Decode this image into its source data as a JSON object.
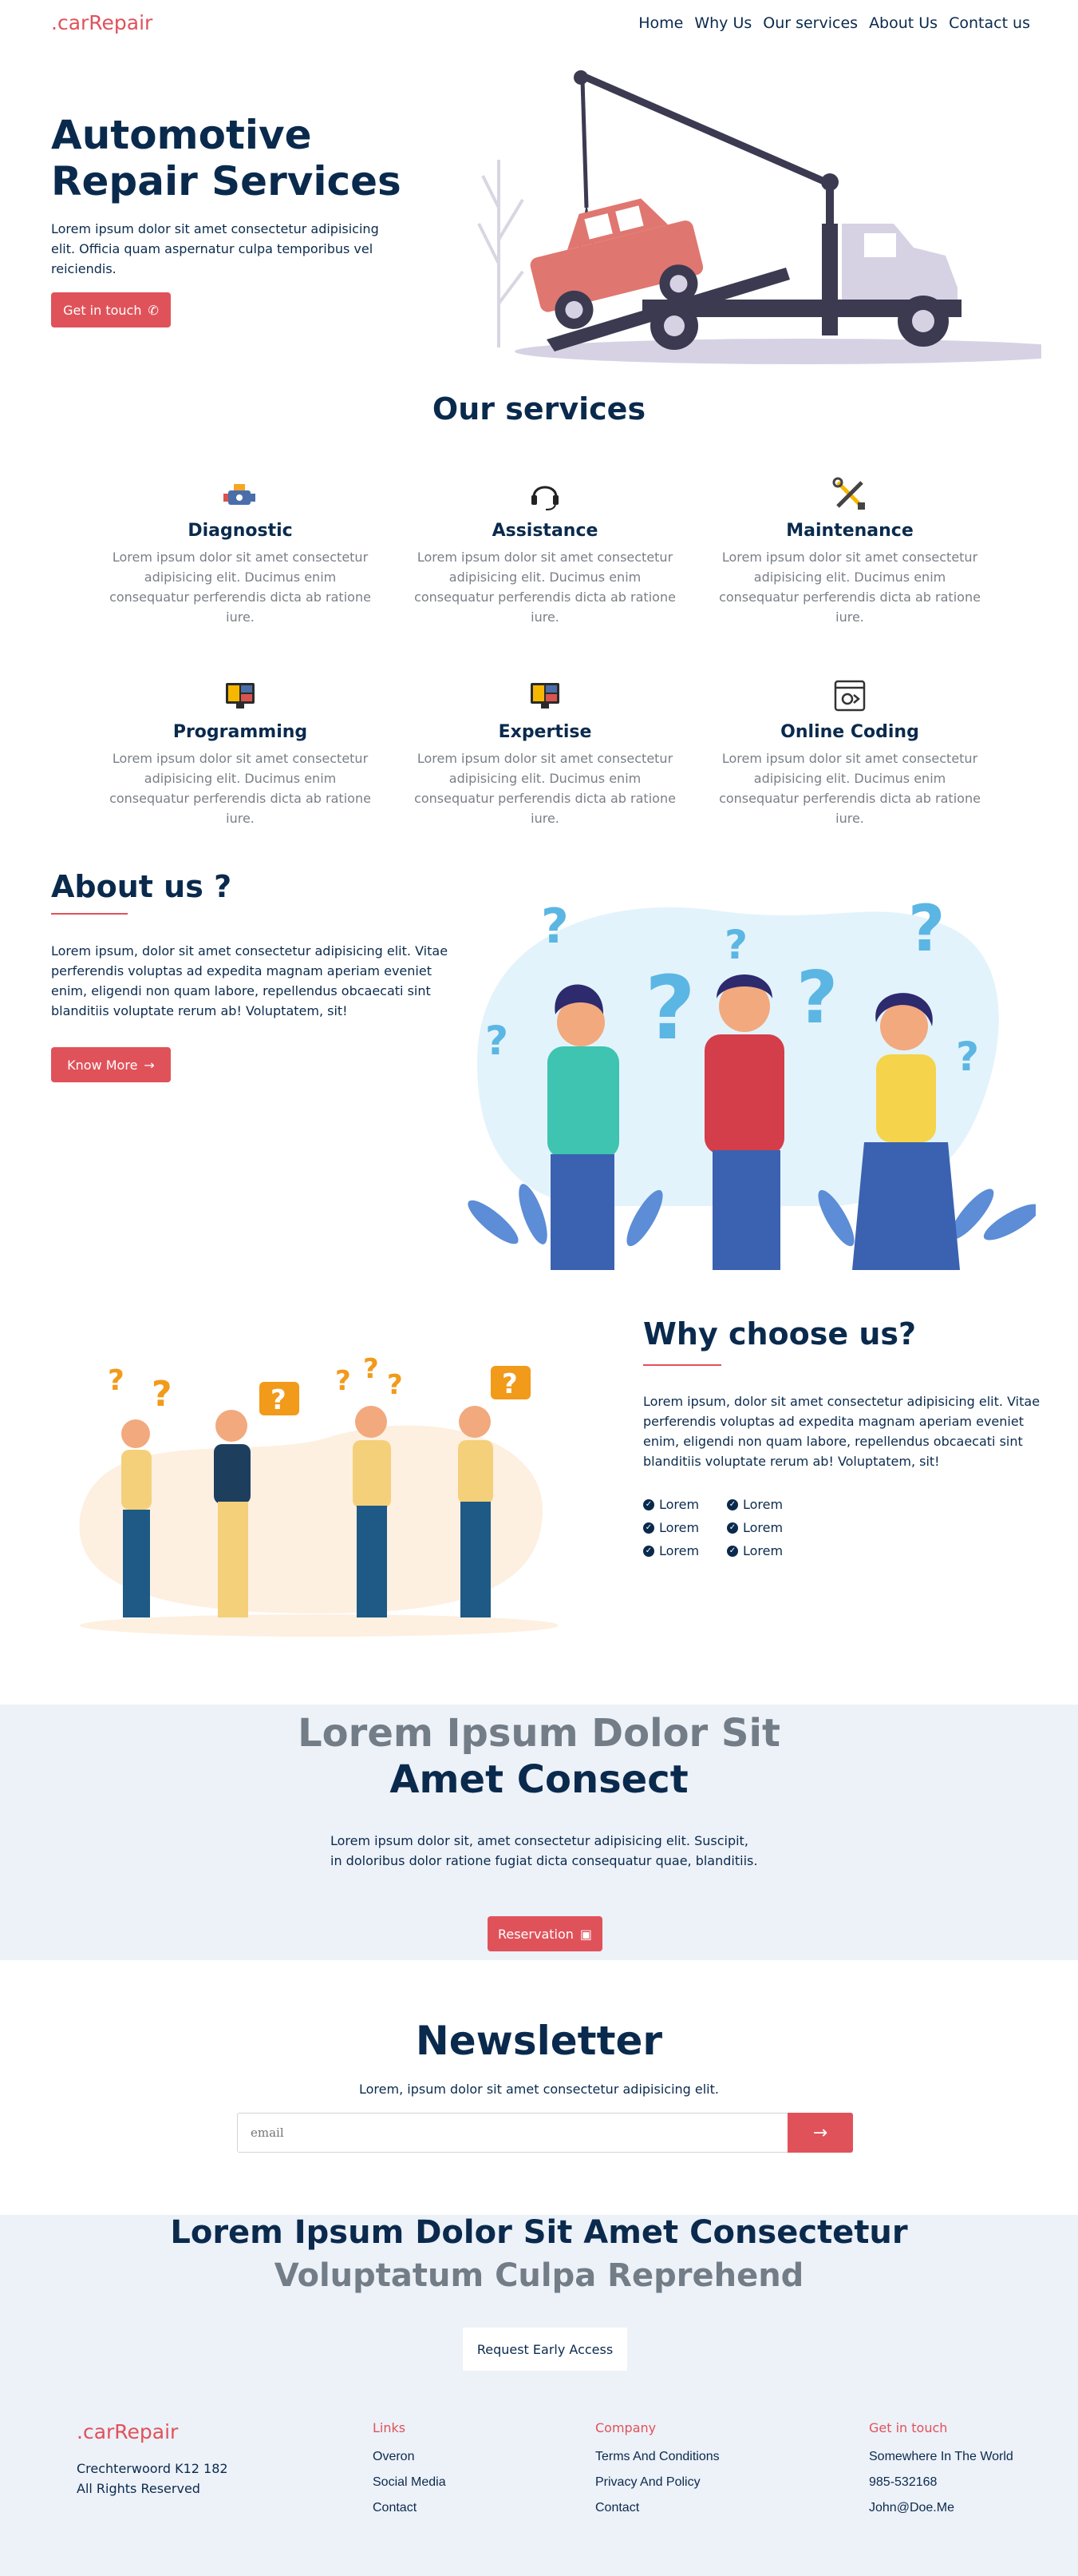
{
  "brand": {
    "logo": ".carRepair",
    "accent": "#e0525a",
    "navy": "#0a2a4d"
  },
  "nav": {
    "links": [
      "Home",
      "Why Us",
      "Our services",
      "About Us",
      "Contact us"
    ]
  },
  "hero": {
    "title": "Automotive Repair Services",
    "text": "Lorem ipsum dolor sit amet consectetur adipisicing elit. Officia quam aspernatur culpa temporibus vel reiciendis.",
    "button": "Get in touch",
    "button_icon": "phone-icon"
  },
  "services": {
    "title": "Our services",
    "items": [
      {
        "name": "Diagnostic",
        "icon": "engine-icon",
        "text": "Lorem ipsum dolor sit amet consectetur adipisicing elit. Ducimus enim consequatur perferendis dicta ab ratione iure."
      },
      {
        "name": "Assistance",
        "icon": "headset-icon",
        "text": "Lorem ipsum dolor sit amet consectetur adipisicing elit. Ducimus enim consequatur perferendis dicta ab ratione iure."
      },
      {
        "name": "Maintenance",
        "icon": "tools-icon",
        "text": "Lorem ipsum dolor sit amet consectetur adipisicing elit. Ducimus enim consequatur perferendis dicta ab ratione iure."
      },
      {
        "name": "Programming",
        "icon": "programming-monitor-icon",
        "text": "Lorem ipsum dolor sit amet consectetur adipisicing elit. Ducimus enim consequatur perferendis dicta ab ratione iure."
      },
      {
        "name": "Expertise",
        "icon": "expertise-monitor-icon",
        "text": "Lorem ipsum dolor sit amet consectetur adipisicing elit. Ducimus enim consequatur perferendis dicta ab ratione iure."
      },
      {
        "name": "Online Coding",
        "icon": "code-window-icon",
        "text": "Lorem ipsum dolor sit amet consectetur adipisicing elit. Ducimus enim consequatur perferendis dicta ab ratione iure."
      }
    ]
  },
  "about": {
    "title": "About us ?",
    "text": "Lorem ipsum, dolor sit amet consectetur adipisicing elit. Vitae perferendis voluptas ad expedita magnam aperiam eveniet enim, eligendi non quam labore, repellendus obcaecati sint blanditiis voluptate rerum ab! Voluptatem, sit!",
    "button": "Know More",
    "button_icon": "arrow-right-icon"
  },
  "why": {
    "title": "Why choose us?",
    "text": "Lorem ipsum, dolor sit amet consectetur adipisicing elit. Vitae perferendis voluptas ad expedita magnam aperiam eveniet enim, eligendi non quam labore, repellendus obcaecati sint blanditiis voluptate rerum ab! Voluptatem, sit!",
    "list": [
      "Lorem",
      "Lorem",
      "Lorem",
      "Lorem",
      "Lorem",
      "Lorem"
    ]
  },
  "cta": {
    "line1": "Lorem Ipsum Dolor Sit",
    "line2": "Amet Consect",
    "text": "Lorem ipsum dolor sit, amet consectetur adipisicing elit. Suscipit, in doloribus dolor ratione fugiat dicta consequatur quae, blanditiis.",
    "button": "Reservation",
    "button_icon": "calendar-icon"
  },
  "newsletter": {
    "title": "Newsletter",
    "subtitle": "Lorem, ipsum dolor sit amet consectetur adipisicing elit.",
    "placeholder": "email",
    "button_icon": "arrow-right-icon"
  },
  "footer": {
    "line1": "Lorem Ipsum Dolor Sit Amet Consectetur",
    "line2": "Voluptatum Culpa Reprehend",
    "early_button": "Request Early Access",
    "logo": ".carRepair",
    "address1": "Crechterwoord K12 182",
    "address2": "All Rights Reserved",
    "columns": [
      {
        "title": "Links",
        "items": [
          "Overon",
          "Social Media",
          "Contact"
        ]
      },
      {
        "title": "Company",
        "items": [
          "Terms And Conditions",
          "Privacy And Policy",
          "Contact"
        ]
      },
      {
        "title": "Get in touch",
        "items": [
          "Somewhere In The World",
          "985-532168",
          "John@Doe.Me"
        ]
      }
    ]
  }
}
